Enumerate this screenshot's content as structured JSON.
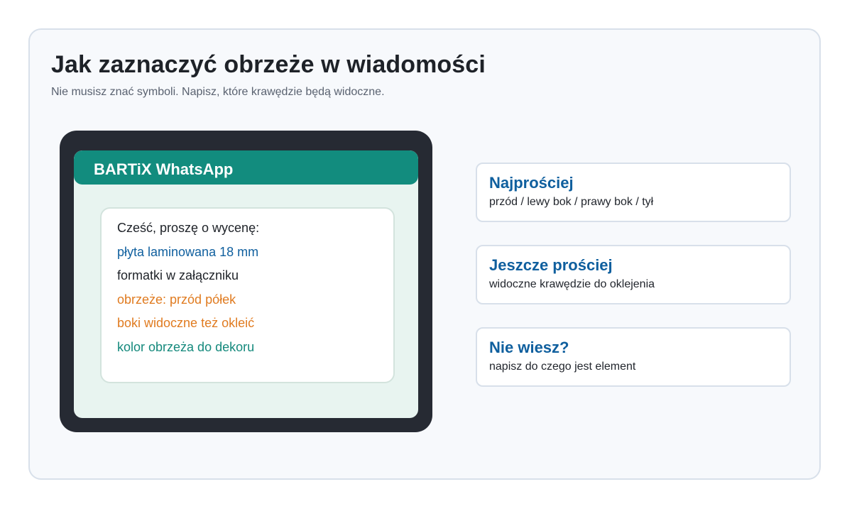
{
  "page": {
    "title": "Jak zaznaczyć obrzeże w wiadomości",
    "subtitle": "Nie musisz znać symboli. Napisz, które krawędzie będą widoczne."
  },
  "chat": {
    "app_name": "BARTiX WhatsApp",
    "message_lines": [
      {
        "text": "Cześć, proszę o wycenę:",
        "color": "#1e2228"
      },
      {
        "text": "płyta laminowana 18 mm",
        "color": "#0f5f9e"
      },
      {
        "text": "formatki w załączniku",
        "color": "#1e2228"
      },
      {
        "text": "obrzeże: przód półek",
        "color": "#e07b20"
      },
      {
        "text": "boki widoczne też okleić",
        "color": "#e07b20"
      },
      {
        "text": "kolor obrzeża do dekoru",
        "color": "#14897c"
      }
    ]
  },
  "tips": [
    {
      "title": "Najprościej",
      "text": "przód / lewy bok / prawy bok / tył"
    },
    {
      "title": "Jeszcze prościej",
      "text": "widoczne krawędzie do oklejenia"
    },
    {
      "title": "Nie wiesz?",
      "text": "napisz do czego jest element"
    }
  ],
  "colors": {
    "brand_green": "#128c7e",
    "accent_blue": "#0f5f9e",
    "accent_orange": "#e07b20",
    "phone_frame": "#262a33",
    "chat_background": "#e8f4f0"
  }
}
